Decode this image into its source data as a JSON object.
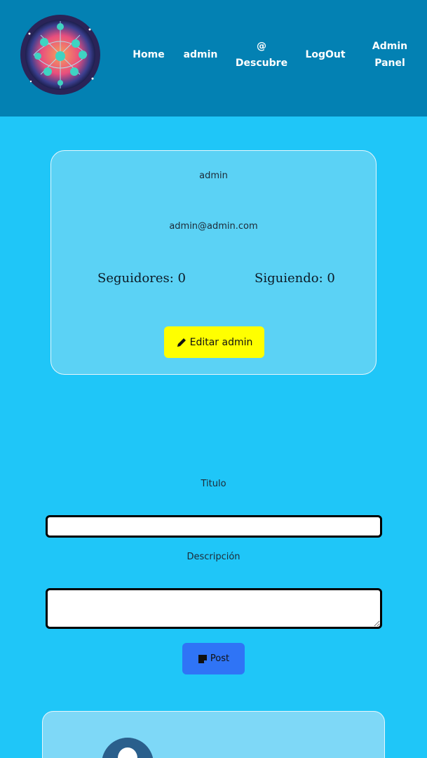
{
  "header": {
    "nav": {
      "home": "Home",
      "user": "admin",
      "descubre_at": "@",
      "descubre": "Descubre",
      "logout": "LogOut",
      "admin_panel_1": "Admin",
      "admin_panel_2": "Panel"
    }
  },
  "profile": {
    "username": "admin",
    "email": "admin@admin.com",
    "followers_label": "Seguidores: 0",
    "following_label": "Siguiendo: 0",
    "edit_button": "Editar admin"
  },
  "post_form": {
    "title_label": "Titulo",
    "title_value": "",
    "description_label": "Descripción",
    "description_value": "",
    "submit_button": "Post"
  },
  "colors": {
    "header_bg": "#0381b3",
    "page_bg": "#1fc6f8",
    "edit_button_bg": "#ffff00",
    "post_button_bg": "#2f74f6"
  },
  "icons": {
    "logo": "network-globe-logo",
    "edit": "pencil-icon",
    "post": "note-icon",
    "avatar": "user-avatar-icon"
  }
}
